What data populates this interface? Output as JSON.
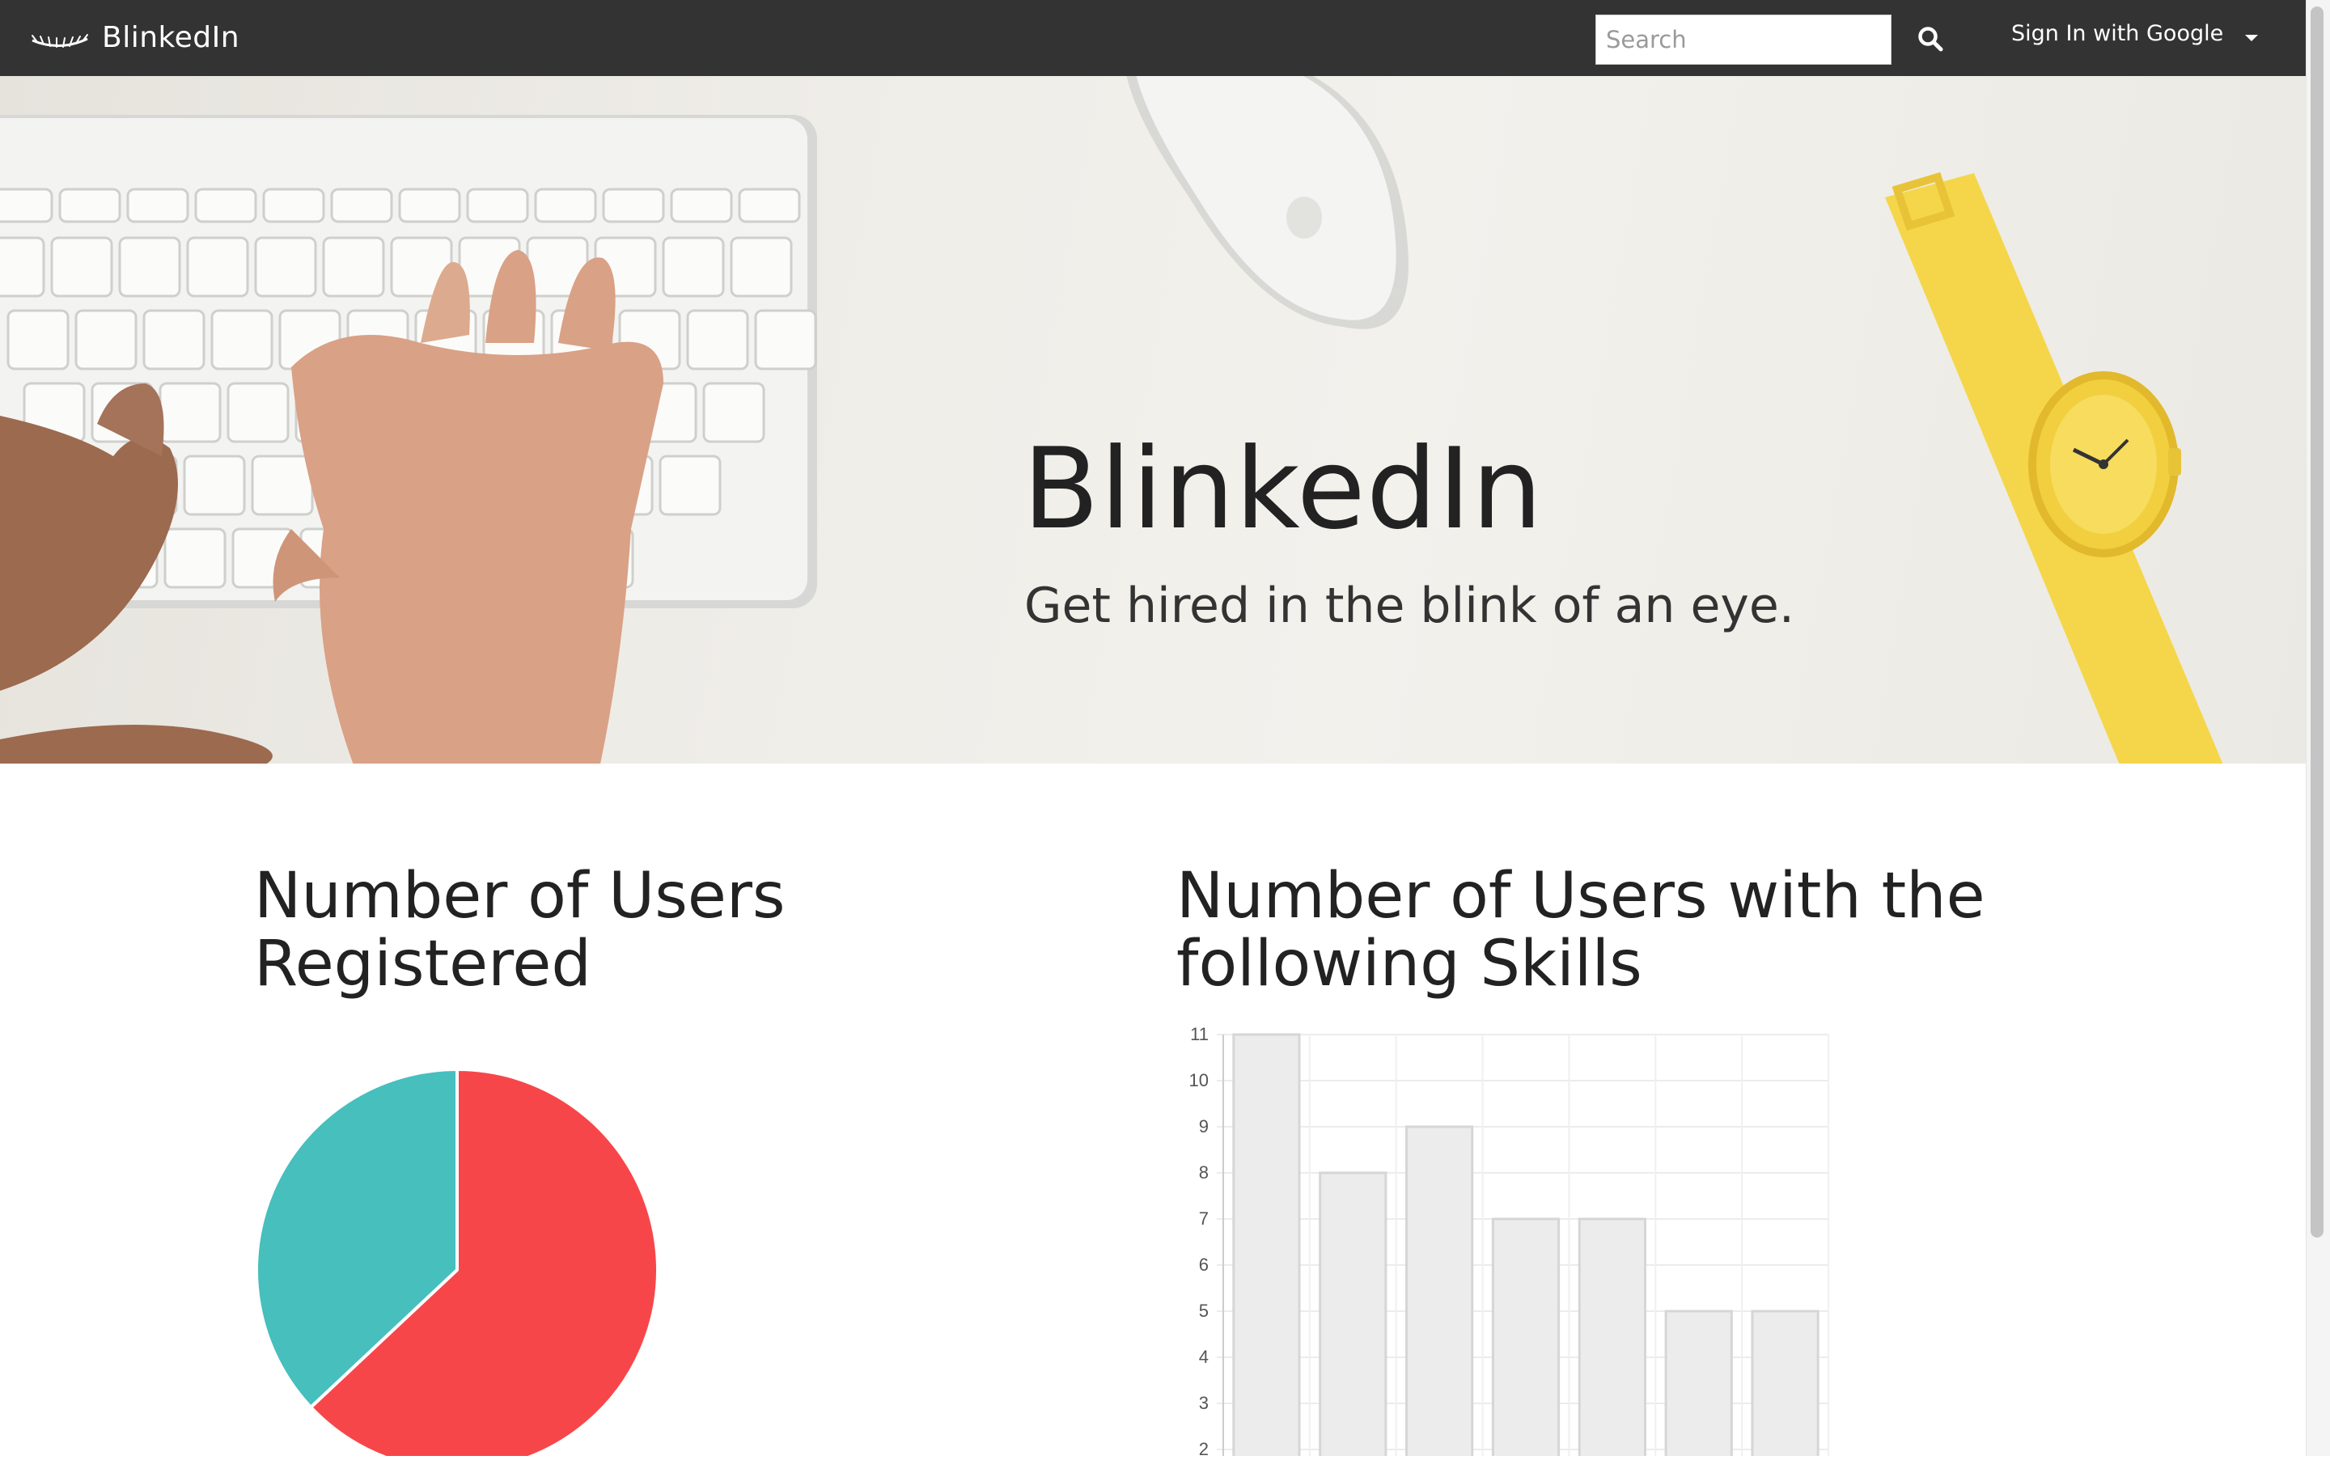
{
  "navbar": {
    "brand": "BlinkedIn",
    "search_placeholder": "Search",
    "search_value": "",
    "signin_label": "Sign In with Google"
  },
  "hero": {
    "title": "BlinkedIn",
    "subtitle": "Get hired in the blink of an eye."
  },
  "sections": {
    "users_registered_title": "Number of Users Registered",
    "skills_title": "Number of Users with the following Skills"
  },
  "colors": {
    "navbar_bg": "#333333",
    "pie_red": "#f7464a",
    "pie_teal": "#46bfbd",
    "bar_fill": "#ececec",
    "bar_stroke": "#d6d6d6"
  },
  "chart_data": [
    {
      "type": "pie",
      "slices": [
        {
          "value": 63,
          "color": "#f7464a"
        },
        {
          "value": 37,
          "color": "#46bfbd"
        }
      ]
    },
    {
      "type": "bar",
      "categories": [
        "",
        "",
        "",
        "",
        "",
        "",
        ""
      ],
      "values": [
        11,
        8,
        9,
        7,
        7,
        5,
        5
      ],
      "ylim": [
        2,
        11
      ],
      "yticks": [
        11,
        10,
        9,
        8,
        7,
        6,
        5,
        4,
        3,
        2
      ],
      "grid": true
    }
  ]
}
